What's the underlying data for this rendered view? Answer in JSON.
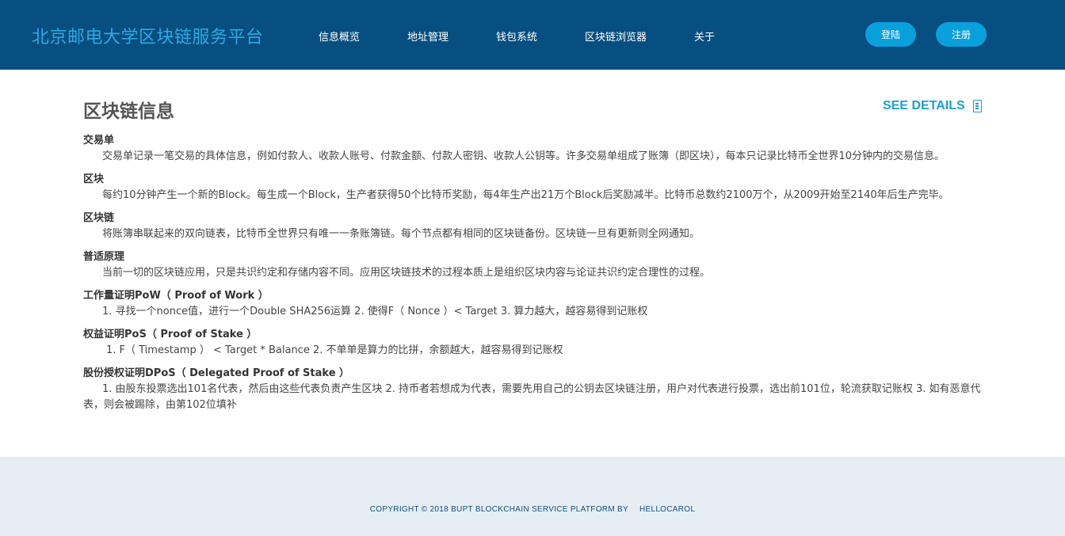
{
  "header": {
    "brand": "北京邮电大学区块链服务平台",
    "nav": [
      "信息概览",
      "地址管理",
      "钱包系统",
      "区块链浏览器",
      "关于"
    ],
    "login_label": "登陆",
    "register_label": "注册"
  },
  "main": {
    "title": "区块链信息",
    "see_details": "SEE DETAILS",
    "sections": [
      {
        "title": "交易单",
        "body": "交易单记录一笔交易的具体信息，例如付款人、收款人账号、付款金额、付款人密钥、收款人公钥等。许多交易单组成了账簿（即区块），每本只记录比特币全世界10分钟内的交易信息。"
      },
      {
        "title": "区块",
        "body": "每约10分钟产生一个新的Block。每生成一个Block，生产者获得50个比特币奖励，每4年生产出21万个Block后奖励减半。比特币总数约2100万个，从2009开始至2140年后生产完毕。"
      },
      {
        "title": "区块链",
        "body": "将账簿串联起来的双向链表，比特币全世界只有唯一一条账簿链。每个节点都有相同的区块链备份。区块链一旦有更新则全网通知。"
      },
      {
        "title": "普适原理",
        "body": "当前一切的区块链应用，只是共识约定和存储内容不同。应用区块链技术的过程本质上是组织区块内容与论证共识约定合理性的过程。"
      },
      {
        "title": "工作量证明PoW（ Proof of Work ）",
        "body": "1. 寻找一个nonce值，进行一个Double SHA256运算 2. 使得F（ Nonce ）< Target 3. 算力越大，越容易得到记账权"
      },
      {
        "title": "权益证明PoS（ Proof of Stake ）",
        "body": "1. F（ Timestamp ） < Target * Balance 2. 不单单是算力的比拼，余额越大，越容易得到记账权"
      },
      {
        "title": "股份授权证明DPoS（ Delegated Proof of Stake ）",
        "body": "1. 由股东投票选出101名代表，然后由这些代表负责产生区块 2. 持币者若想成为代表，需要先用自己的公钥去区块链注册，用户对代表进行投票，选出前101位，轮流获取记账权 3. 如有恶意代表，则会被踢除，由第102位填补"
      }
    ]
  },
  "footer": {
    "copyright": "COPYRIGHT © 2018 BUPT BLOCKCHAIN SERVICE PLATFORM BY",
    "author": "HELLOCAROL"
  },
  "colors": {
    "header_bg": "#064f80",
    "brand": "#2ea8e2",
    "button": "#0aa0dc",
    "accent": "#1a9fd8",
    "footer_bg": "#e4eef3"
  }
}
